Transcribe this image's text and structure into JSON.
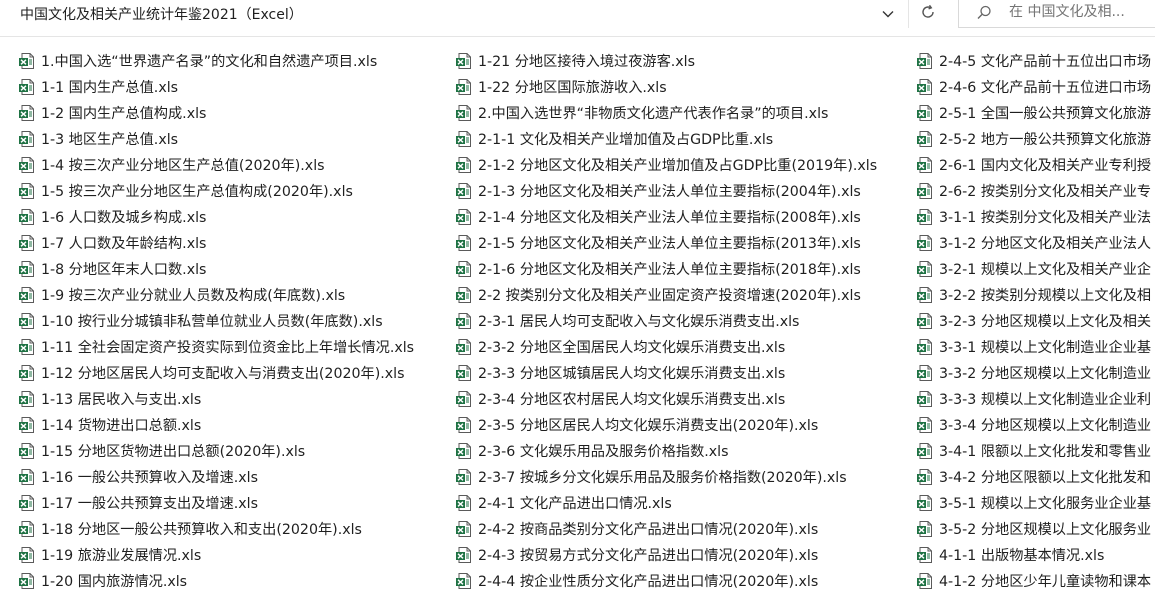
{
  "address": {
    "path": "中国文化及相关产业统计年鉴2021（Excel）"
  },
  "search": {
    "placeholder": "在 中国文化及相..."
  },
  "icons": {
    "file": "excel-file-icon",
    "chevron": "chevron-down-icon",
    "refresh": "refresh-icon",
    "search": "search-icon"
  },
  "colors": {
    "excel_green": "#1f7244",
    "text": "#1f1f1f"
  },
  "files": {
    "col1": [
      "1.中国入选“世界遗产名录”的文化和自然遗产项目.xls",
      "1-1 国内生产总值.xls",
      "1-2 国内生产总值构成.xls",
      "1-3 地区生产总值.xls",
      "1-4 按三次产业分地区生产总值(2020年).xls",
      "1-5 按三次产业分地区生产总值构成(2020年).xls",
      "1-6 人口数及城乡构成.xls",
      "1-7 人口数及年龄结构.xls",
      "1-8 分地区年末人口数.xls",
      "1-9 按三次产业分就业人员数及构成(年底数).xls",
      "1-10 按行业分城镇非私营单位就业人员数(年底数).xls",
      "1-11 全社会固定资产投资实际到位资金比上年增长情况.xls",
      "1-12 分地区居民人均可支配收入与消费支出(2020年).xls",
      "1-13 居民收入与支出.xls",
      "1-14 货物进出口总额.xls",
      "1-15 分地区货物进出口总额(2020年).xls",
      "1-16 一般公共预算收入及增速.xls",
      "1-17 一般公共预算支出及增速.xls",
      "1-18 分地区一般公共预算收入和支出(2020年).xls",
      "1-19 旅游业发展情况.xls",
      "1-20 国内旅游情况.xls"
    ],
    "col2": [
      "1-21 分地区接待入境过夜游客.xls",
      "1-22 分地区国际旅游收入.xls",
      "2.中国入选世界“非物质文化遗产代表作名录”的项目.xls",
      "2-1-1 文化及相关产业增加值及占GDP比重.xls",
      "2-1-2 分地区文化及相关产业增加值及占GDP比重(2019年).xls",
      "2-1-3 分地区文化及相关产业法人单位主要指标(2004年).xls",
      "2-1-4 分地区文化及相关产业法人单位主要指标(2008年).xls",
      "2-1-5 分地区文化及相关产业法人单位主要指标(2013年).xls",
      "2-1-6 分地区文化及相关产业法人单位主要指标(2018年).xls",
      "2-2 按类别分文化及相关产业固定资产投资增速(2020年).xls",
      "2-3-1 居民人均可支配收入与文化娱乐消费支出.xls",
      "2-3-2 分地区全国居民人均文化娱乐消费支出.xls",
      "2-3-3 分地区城镇居民人均文化娱乐消费支出.xls",
      "2-3-4 分地区农村居民人均文化娱乐消费支出.xls",
      "2-3-5 分地区居民人均文化娱乐消费支出(2020年).xls",
      "2-3-6 文化娱乐用品及服务价格指数.xls",
      "2-3-7 按城乡分文化娱乐用品及服务价格指数(2020年).xls",
      "2-4-1 文化产品进出口情况.xls",
      "2-4-2 按商品类别分文化产品进出口情况(2020年).xls",
      "2-4-3 按贸易方式分文化产品进出口情况(2020年).xls",
      "2-4-4 按企业性质分文化产品进出口情况(2020年).xls"
    ],
    "col3": [
      "2-4-5 文化产品前十五位出口市场",
      "2-4-6 文化产品前十五位进口市场",
      "2-5-1 全国一般公共预算文化旅游",
      "2-5-2 地方一般公共预算文化旅游",
      "2-6-1 国内文化及相关产业专利授",
      "2-6-2 按类别分文化及相关产业专",
      "3-1-1 按类别分文化及相关产业法",
      "3-1-2 分地区文化及相关产业法人",
      "3-2-1 规模以上文化及相关产业企",
      "3-2-2 按类别分规模以上文化及相",
      "3-2-3 分地区规模以上文化及相关",
      "3-3-1 规模以上文化制造业企业基",
      "3-3-2 分地区规模以上文化制造业",
      "3-3-3 规模以上文化制造业企业利",
      "3-3-4 分地区规模以上文化制造业",
      "3-4-1 限额以上文化批发和零售业",
      "3-4-2 分地区限额以上文化批发和",
      "3-5-1 规模以上文化服务业企业基",
      "3-5-2 分地区规模以上文化服务业",
      "4-1-1 出版物基本情况.xls",
      "4-1-2 分地区少年儿童读物和课本"
    ]
  }
}
